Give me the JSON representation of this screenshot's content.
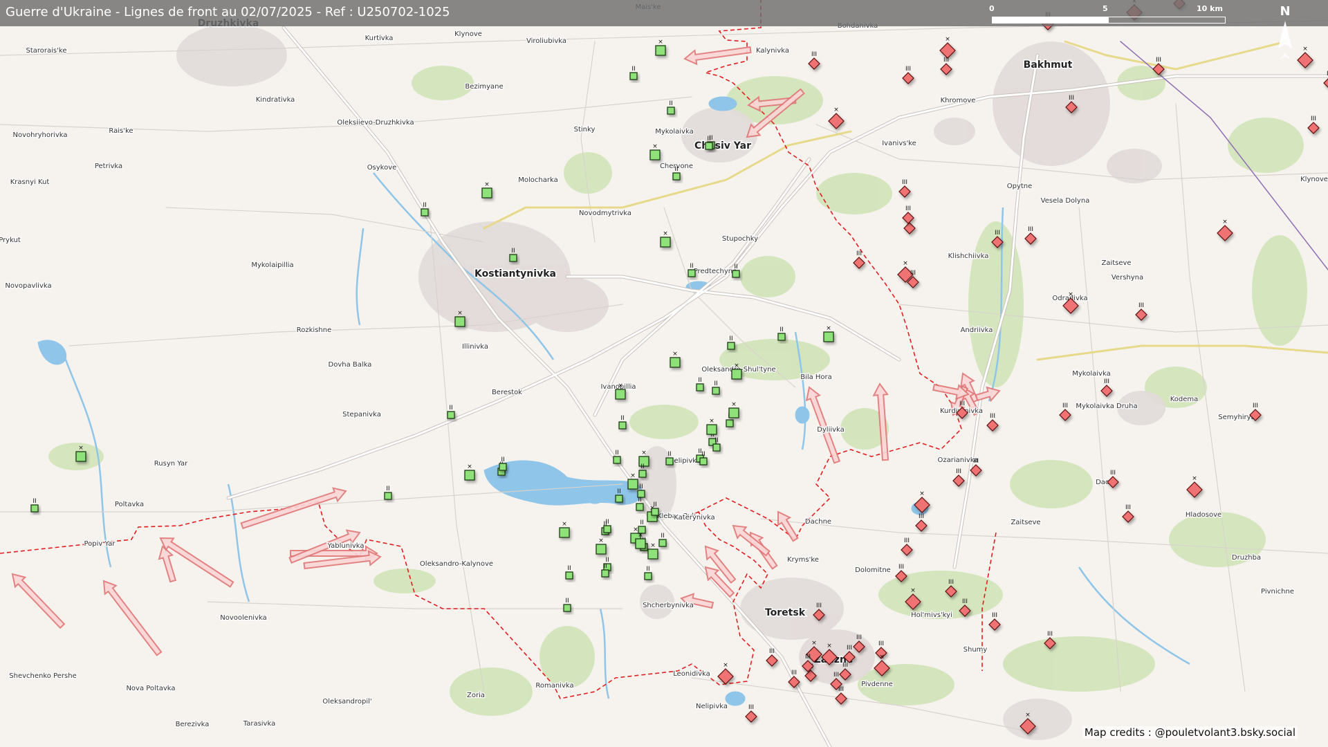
{
  "title": "Guerre d'Ukraine - Lignes de front au 02/07/2025 - Ref : U250702-1025",
  "scale": {
    "labels": [
      "0",
      "5",
      "10 km"
    ]
  },
  "north_label": "N",
  "credits": "Map credits : @pouletvolant3.bsky.social",
  "colors": {
    "map_bg": "#f6f3ef",
    "road": "#ffffff",
    "primary_road": "#e6d98a",
    "water": "#8ec5e8",
    "green": "#cfe3b5",
    "urban": "#e2dbd9",
    "front": "#e11d1d",
    "arrow": "#f28a8a",
    "ukr": "#8fe27a",
    "rus": "#f07373"
  },
  "cities": [
    {
      "name": "Kostiantynivka",
      "big": true
    },
    {
      "name": "Chasiv Yar",
      "big": true
    },
    {
      "name": "Bakhmut",
      "big": true
    },
    {
      "name": "Toretsk",
      "big": true
    },
    {
      "name": "Zalizne",
      "big": true
    },
    {
      "name": "Druzhkivka",
      "big": true
    }
  ],
  "towns": [
    "Mais'ke",
    "Bohdanivka",
    "Kurtivka",
    "Klynove",
    "Viroliubivka",
    "Kalynivka",
    "Starorais'ke",
    "Bezimyane",
    "Kindrativka",
    "Oleksiievo-Druzhkivka",
    "Stinky",
    "Mykolaivka",
    "Novohryhorivka",
    "Rais'ke",
    "Chervone",
    "Petrivka",
    "Osykove",
    "Molocharka",
    "Krasnyi Kut",
    "Novodmytrivka",
    "Prykut",
    "Stupochky",
    "Mykolaipillia",
    "Predtechyne",
    "Novopavlivka",
    "Rozkishne",
    "Illinivka",
    "Dovha Balka",
    "Oleksandro-Shul'tyne",
    "Bila Hora",
    "Berestok",
    "Ivanopillia",
    "Stepanivka",
    "Dyliivka",
    "Rusyn Yar",
    "Nelipivka",
    "Poltavka",
    "Popiv Yar",
    "Yablunivka",
    "Kleban-Byk",
    "Katerynivka",
    "Oleksandro-Kalynove",
    "Kryms'ke",
    "Dachne",
    "Shcherbynivka",
    "Novoolenivka",
    "Shevchenko Pershe",
    "Nova Poltavka",
    "Leonidivka",
    "Oleksandropil'",
    "Zoria",
    "Romanivka",
    "Nelipivka",
    "Tarasivka",
    "Berezivka",
    "Ivanivs'ke",
    "Khromove",
    "Opytne",
    "Vesela Dolyna",
    "Klishchiivka",
    "Zaitseve",
    "Vershyna",
    "Odradivka",
    "Andriivka",
    "Mykolaivka",
    "Mykolaivka Druha",
    "Kodema",
    "Semyhirya",
    "Kurdiumivka",
    "Ozarianivka",
    "Dacha",
    "Hladosove",
    "Zaitseve",
    "Druzhba",
    "Dolomitne",
    "Pivnichne",
    "Hol'mivs'kyi",
    "Shumy",
    "Pivdenne",
    "Klynove"
  ],
  "ukr_units": 62,
  "rus_units": 60,
  "arrows": 24
}
